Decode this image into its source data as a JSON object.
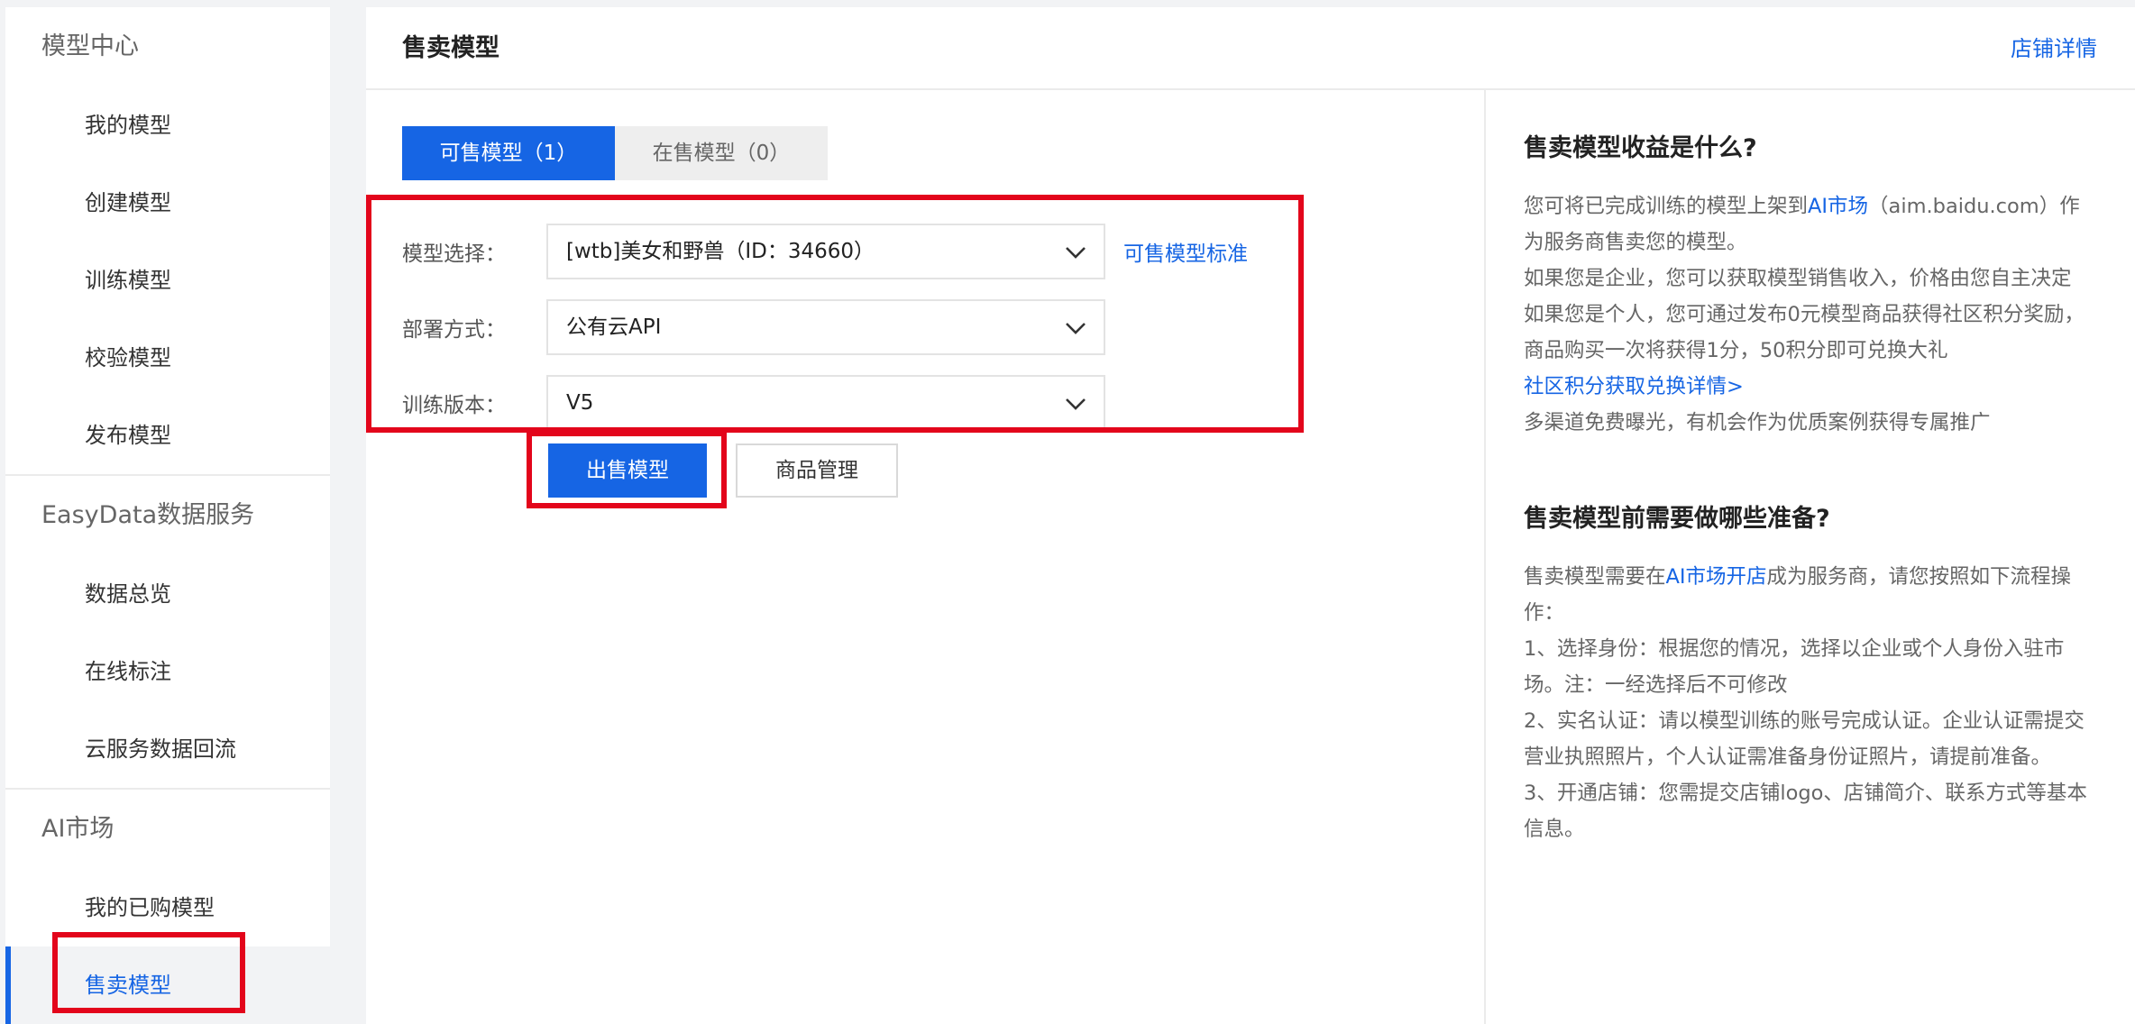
{
  "sidebar": {
    "groups": [
      {
        "title": "模型中心",
        "items": [
          "我的模型",
          "创建模型",
          "训练模型",
          "校验模型",
          "发布模型"
        ]
      },
      {
        "title": "EasyData数据服务",
        "items": [
          "数据总览",
          "在线标注",
          "云服务数据回流"
        ]
      },
      {
        "title": "AI市场",
        "items": [
          "我的已购模型",
          "售卖模型"
        ]
      }
    ]
  },
  "header": {
    "title": "售卖模型",
    "store_link": "店铺详情"
  },
  "tabs": {
    "sellable": "可售模型（1）",
    "on_sale": "在售模型（0）"
  },
  "form": {
    "model_label": "模型选择：",
    "model_value": "[wtb]美女和野兽（ID：34660）",
    "model_standard_link": "可售模型标准",
    "deploy_label": "部署方式：",
    "deploy_value": "公有云API",
    "version_label": "训练版本：",
    "version_value": "V5"
  },
  "actions": {
    "sell_button": "出售模型",
    "manage_button": "商品管理"
  },
  "help": {
    "q1_title": "售卖模型收益是什么?",
    "q1_p1_a": "您可将已完成训练的模型上架到",
    "q1_p1_link": "AI市场",
    "q1_p1_b": "（aim.baidu.com）作为服务商售卖您的模型。",
    "q1_p2": "如果您是企业，您可以获取模型销售收入，价格由您自主决定",
    "q1_p3": "如果您是个人，您可通过发布0元模型商品获得社区积分奖励，商品购买一次将获得1分，50积分即可兑换大礼",
    "q1_p3_link": "社区积分获取兑换详情>",
    "q1_p4": "多渠道免费曝光，有机会作为优质案例获得专属推广",
    "q2_title": "售卖模型前需要做哪些准备?",
    "q2_p1_a": "售卖模型需要在",
    "q2_p1_link": "AI市场开店",
    "q2_p1_b": "成为服务商，请您按照如下流程操作：",
    "q2_p2": "1、选择身份：根据您的情况，选择以企业或个人身份入驻市场。注：一经选择后不可修改",
    "q2_p3": "2、实名认证：请以模型训练的账号完成认证。企业认证需提交营业执照照片，个人认证需准备身份证照片，请提前准备。",
    "q2_p4": "3、开通店铺：您需提交店铺logo、店铺简介、联系方式等基本信息。"
  },
  "colors": {
    "accent": "#1665e4",
    "highlight": "#e3051b"
  }
}
